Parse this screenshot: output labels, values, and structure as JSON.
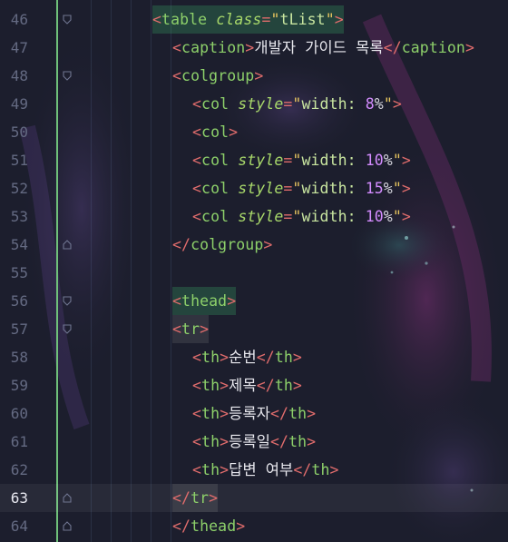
{
  "editor": {
    "active_line": "63",
    "lines": [
      {
        "num": "46",
        "fold": "open",
        "indent": 0,
        "hl": "green",
        "tokens": [
          [
            "br",
            "<"
          ],
          [
            "tag",
            "table"
          ],
          [
            "txt",
            " "
          ],
          [
            "attr",
            "class"
          ],
          [
            "eq",
            "="
          ],
          [
            "q",
            "\""
          ],
          [
            "str",
            "tList"
          ],
          [
            "q",
            "\""
          ],
          [
            "br",
            ">"
          ]
        ]
      },
      {
        "num": "47",
        "fold": "none",
        "indent": 1,
        "tokens": [
          [
            "br",
            "<"
          ],
          [
            "tag",
            "caption"
          ],
          [
            "br",
            ">"
          ],
          [
            "txt",
            "개발자 가이드 목록"
          ],
          [
            "br",
            "</"
          ],
          [
            "tag",
            "caption"
          ],
          [
            "br",
            ">"
          ]
        ]
      },
      {
        "num": "48",
        "fold": "open",
        "indent": 1,
        "tokens": [
          [
            "br",
            "<"
          ],
          [
            "tag",
            "colgroup"
          ],
          [
            "br",
            ">"
          ]
        ]
      },
      {
        "num": "49",
        "fold": "none",
        "indent": 2,
        "tokens": [
          [
            "br",
            "<"
          ],
          [
            "tag",
            "col"
          ],
          [
            "txt",
            " "
          ],
          [
            "attr",
            "style"
          ],
          [
            "eq",
            "="
          ],
          [
            "q",
            "\""
          ],
          [
            "str",
            "width: "
          ],
          [
            "num",
            "8"
          ],
          [
            "pct",
            "%"
          ],
          [
            "q",
            "\""
          ],
          [
            "br",
            ">"
          ]
        ]
      },
      {
        "num": "50",
        "fold": "none",
        "indent": 2,
        "tokens": [
          [
            "br",
            "<"
          ],
          [
            "tag",
            "col"
          ],
          [
            "br",
            ">"
          ]
        ]
      },
      {
        "num": "51",
        "fold": "none",
        "indent": 2,
        "tokens": [
          [
            "br",
            "<"
          ],
          [
            "tag",
            "col"
          ],
          [
            "txt",
            " "
          ],
          [
            "attr",
            "style"
          ],
          [
            "eq",
            "="
          ],
          [
            "q",
            "\""
          ],
          [
            "str",
            "width: "
          ],
          [
            "num",
            "10"
          ],
          [
            "pct",
            "%"
          ],
          [
            "q",
            "\""
          ],
          [
            "br",
            ">"
          ]
        ]
      },
      {
        "num": "52",
        "fold": "none",
        "indent": 2,
        "tokens": [
          [
            "br",
            "<"
          ],
          [
            "tag",
            "col"
          ],
          [
            "txt",
            " "
          ],
          [
            "attr",
            "style"
          ],
          [
            "eq",
            "="
          ],
          [
            "q",
            "\""
          ],
          [
            "str",
            "width: "
          ],
          [
            "num",
            "15"
          ],
          [
            "pct",
            "%"
          ],
          [
            "q",
            "\""
          ],
          [
            "br",
            ">"
          ]
        ]
      },
      {
        "num": "53",
        "fold": "none",
        "indent": 2,
        "tokens": [
          [
            "br",
            "<"
          ],
          [
            "tag",
            "col"
          ],
          [
            "txt",
            " "
          ],
          [
            "attr",
            "style"
          ],
          [
            "eq",
            "="
          ],
          [
            "q",
            "\""
          ],
          [
            "str",
            "width: "
          ],
          [
            "num",
            "10"
          ],
          [
            "pct",
            "%"
          ],
          [
            "q",
            "\""
          ],
          [
            "br",
            ">"
          ]
        ]
      },
      {
        "num": "54",
        "fold": "close",
        "indent": 1,
        "tokens": [
          [
            "br",
            "</"
          ],
          [
            "tag",
            "colgroup"
          ],
          [
            "br",
            ">"
          ]
        ]
      },
      {
        "num": "55",
        "fold": "none",
        "indent": 1,
        "tokens": []
      },
      {
        "num": "56",
        "fold": "open",
        "indent": 1,
        "hl": "green",
        "tokens": [
          [
            "br",
            "<"
          ],
          [
            "tag",
            "thead"
          ],
          [
            "br",
            ">"
          ]
        ]
      },
      {
        "num": "57",
        "fold": "open",
        "indent": 1,
        "hl": "gray",
        "tokens": [
          [
            "br",
            "<"
          ],
          [
            "tag",
            "tr"
          ],
          [
            "br",
            ">"
          ]
        ]
      },
      {
        "num": "58",
        "fold": "none",
        "indent": 2,
        "tokens": [
          [
            "br",
            "<"
          ],
          [
            "tag",
            "th"
          ],
          [
            "br",
            ">"
          ],
          [
            "txt",
            "순번"
          ],
          [
            "br",
            "</"
          ],
          [
            "tag",
            "th"
          ],
          [
            "br",
            ">"
          ]
        ]
      },
      {
        "num": "59",
        "fold": "none",
        "indent": 2,
        "tokens": [
          [
            "br",
            "<"
          ],
          [
            "tag",
            "th"
          ],
          [
            "br",
            ">"
          ],
          [
            "txt",
            "제목"
          ],
          [
            "br",
            "</"
          ],
          [
            "tag",
            "th"
          ],
          [
            "br",
            ">"
          ]
        ]
      },
      {
        "num": "60",
        "fold": "none",
        "indent": 2,
        "tokens": [
          [
            "br",
            "<"
          ],
          [
            "tag",
            "th"
          ],
          [
            "br",
            ">"
          ],
          [
            "txt",
            "등록자"
          ],
          [
            "br",
            "</"
          ],
          [
            "tag",
            "th"
          ],
          [
            "br",
            ">"
          ]
        ]
      },
      {
        "num": "61",
        "fold": "none",
        "indent": 2,
        "tokens": [
          [
            "br",
            "<"
          ],
          [
            "tag",
            "th"
          ],
          [
            "br",
            ">"
          ],
          [
            "txt",
            "등록일"
          ],
          [
            "br",
            "</"
          ],
          [
            "tag",
            "th"
          ],
          [
            "br",
            ">"
          ]
        ]
      },
      {
        "num": "62",
        "fold": "none",
        "indent": 2,
        "tokens": [
          [
            "br",
            "<"
          ],
          [
            "tag",
            "th"
          ],
          [
            "br",
            ">"
          ],
          [
            "txt",
            "답변 여부"
          ],
          [
            "br",
            "</"
          ],
          [
            "tag",
            "th"
          ],
          [
            "br",
            ">"
          ]
        ]
      },
      {
        "num": "63",
        "fold": "close",
        "indent": 1,
        "hl": "gray",
        "tokens": [
          [
            "br",
            "</"
          ],
          [
            "tag",
            "tr"
          ],
          [
            "br",
            ">"
          ]
        ]
      },
      {
        "num": "64",
        "fold": "close",
        "indent": 1,
        "tokens": [
          [
            "br",
            "</"
          ],
          [
            "tag",
            "thead"
          ],
          [
            "br",
            ">"
          ]
        ]
      }
    ]
  }
}
